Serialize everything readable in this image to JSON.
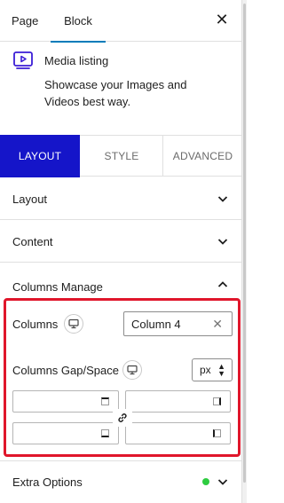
{
  "header": {
    "tabs": [
      {
        "label": "Page",
        "active": false
      },
      {
        "label": "Block",
        "active": true
      }
    ],
    "close_icon": "close-icon",
    "accent": "#007cba"
  },
  "block": {
    "icon": "video-play-icon",
    "title": "Media listing",
    "description": "Showcase your Images and Videos best way."
  },
  "segments": {
    "items": [
      {
        "label": "LAYOUT",
        "active": true
      },
      {
        "label": "STYLE",
        "active": false
      },
      {
        "label": "ADVANCED",
        "active": false
      }
    ],
    "active_color": "#1515c9"
  },
  "sections": {
    "layout": {
      "label": "Layout",
      "expanded": false
    },
    "content": {
      "label": "Content",
      "expanded": false
    },
    "columns_manage": {
      "label": "Columns Manage",
      "expanded": true,
      "columns": {
        "label": "Columns",
        "device_icon": "desktop-icon",
        "value": "Column 4",
        "clear_icon": "clear-icon"
      },
      "gap": {
        "label": "Columns Gap/Space",
        "device_icon": "desktop-icon",
        "unit": "px",
        "top": "",
        "right": "",
        "bottom": "",
        "left": "",
        "link_icon": "link-icon"
      }
    },
    "extra_options": {
      "label": "Extra Options",
      "expanded": false,
      "status_color": "#2ecc40"
    }
  },
  "highlight_color": "#e0162b"
}
